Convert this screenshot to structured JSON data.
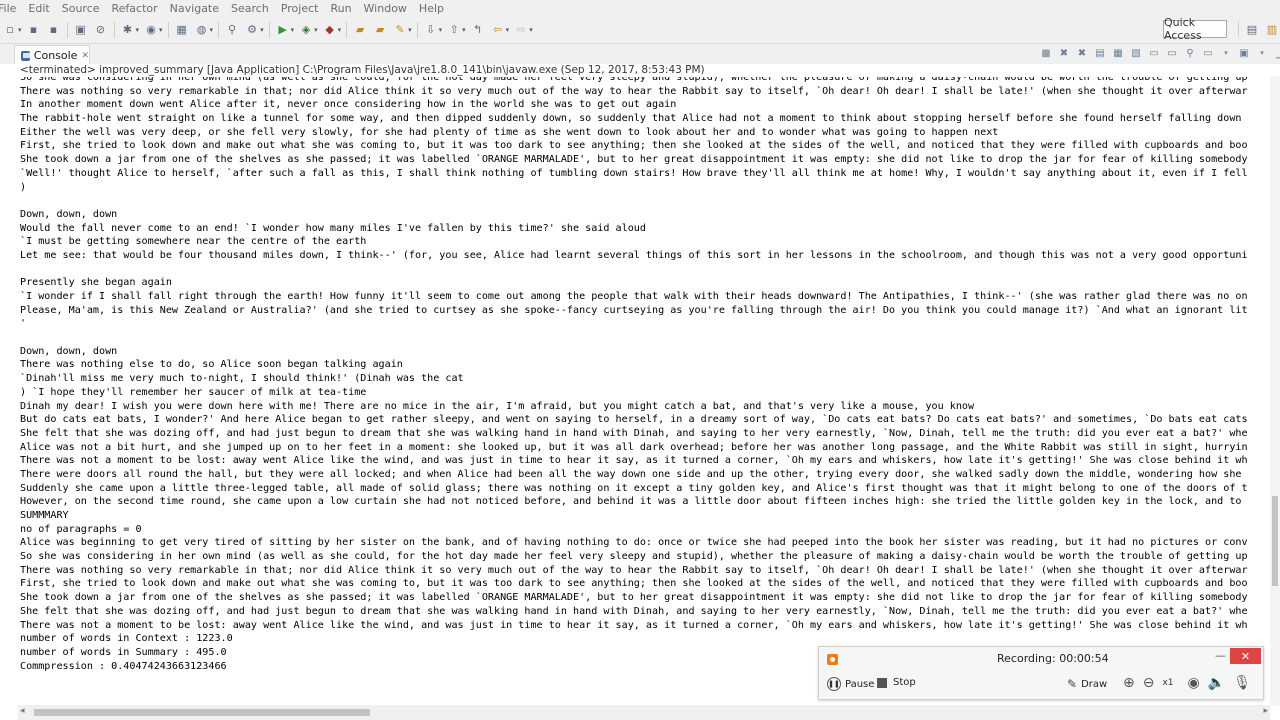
{
  "menu": [
    "File",
    "Edit",
    "Source",
    "Refactor",
    "Navigate",
    "Search",
    "Project",
    "Run",
    "Window",
    "Help"
  ],
  "toolbar": {
    "quick_access": "Quick Access"
  },
  "console_view": {
    "tab_label": "Console",
    "tab_close": "✕",
    "status": "<terminated> improved_summary [Java Application] C:\\Program Files\\Java\\jre1.8.0_141\\bin\\javaw.exe (Sep 12, 2017, 8:53:43 PM)"
  },
  "lines": [
    "So she was considering in her own mind (as well as she could, for the hot day made her feel very sleepy and stupid), whether the pleasure of making a daisy-chain would be worth the trouble of getting up",
    "There was nothing so very remarkable in that; nor did Alice think it so very much out of the way to hear the Rabbit say to itself, `Oh dear! Oh dear! I shall be late!' (when she thought it over afterwar",
    "In another moment down went Alice after it, never once considering how in the world she was to get out again",
    "The rabbit-hole went straight on like a tunnel for some way, and then dipped suddenly down, so suddenly that Alice had not a moment to think about stopping herself before she found herself falling down",
    "Either the well was very deep, or she fell very slowly, for she had plenty of time as she went down to look about her and to wonder what was going to happen next",
    "First, she tried to look down and make out what she was coming to, but it was too dark to see anything; then she looked at the sides of the well, and noticed that they were filled with cupboards and boo",
    "She took down a jar from one of the shelves as she passed; it was labelled `ORANGE MARMALADE', but to her great disappointment it was empty: she did not like to drop the jar for fear of killing somebody",
    "`Well!' thought Alice to herself, `after such a fall as this, I shall think nothing of tumbling down stairs! How brave they'll all think me at home! Why, I wouldn't say anything about it, even if I fell",
    ")",
    "",
    "Down, down, down",
    "Would the fall never come to an end! `I wonder how many miles I've fallen by this time?' she said aloud",
    "`I must be getting somewhere near the centre of the earth",
    "Let me see: that would be four thousand miles down, I think--' (for, you see, Alice had learnt several things of this sort in her lessons in the schoolroom, and though this was not a very good opportuni",
    "",
    "Presently she began again",
    "`I wonder if I shall fall right through the earth! How funny it'll seem to come out among the people that walk with their heads downward! The Antipathies, I think--' (she was rather glad there was no on",
    "Please, Ma'am, is this New Zealand or Australia?' (and she tried to curtsey as she spoke--fancy curtseying as you're falling through the air! Do you think you could manage it?) `And what an ignorant lit",
    "'",
    "",
    "Down, down, down",
    "There was nothing else to do, so Alice soon began talking again",
    "`Dinah'll miss me very much to-night, I should think!' (Dinah was the cat",
    ") `I hope they'll remember her saucer of milk at tea-time",
    "Dinah my dear! I wish you were down here with me! There are no mice in the air, I'm afraid, but you might catch a bat, and that's very like a mouse, you know",
    "But do cats eat bats, I wonder?' And here Alice began to get rather sleepy, and went on saying to herself, in a dreamy sort of way, `Do cats eat bats? Do cats eat bats?' and sometimes, `Do bats eat cats",
    "She felt that she was dozing off, and had just begun to dream that she was walking hand in hand with Dinah, and saying to her very earnestly, `Now, Dinah, tell me the truth: did you ever eat a bat?' whe",
    "Alice was not a bit hurt, and she jumped up on to her feet in a moment: she looked up, but it was all dark overhead; before her was another long passage, and the White Rabbit was still in sight, hurryin",
    "There was not a moment to be lost: away went Alice like the wind, and was just in time to hear it say, as it turned a corner, `Oh my ears and whiskers, how late it's getting!' She was close behind it wh",
    "There were doors all round the hall, but they were all locked; and when Alice had been all the way down one side and up the other, trying every door, she walked sadly down the middle, wondering how she",
    "Suddenly she came upon a little three-legged table, all made of solid glass; there was nothing on it except a tiny golden key, and Alice's first thought was that it might belong to one of the doors of t",
    "However, on the second time round, she came upon a low curtain she had not noticed before, and behind it was a little door about fifteen inches high: she tried the little golden key in the lock, and to",
    "SUMMMARY",
    "no of paragraphs = 0",
    "Alice was beginning to get very tired of sitting by her sister on the bank, and of having nothing to do: once or twice she had peeped into the book her sister was reading, but it had no pictures or conv",
    "So she was considering in her own mind (as well as she could, for the hot day made her feel very sleepy and stupid), whether the pleasure of making a daisy-chain would be worth the trouble of getting up",
    "There was nothing so very remarkable in that; nor did Alice think it so very much out of the way to hear the Rabbit say to itself, `Oh dear! Oh dear! I shall be late!' (when she thought it over afterwar",
    "First, she tried to look down and make out what she was coming to, but it was too dark to see anything; then she looked at the sides of the well, and noticed that they were filled with cupboards and boo",
    "She took down a jar from one of the shelves as she passed; it was labelled `ORANGE MARMALADE', but to her great disappointment it was empty: she did not like to drop the jar for fear of killing somebody",
    "She felt that she was dozing off, and had just begun to dream that she was walking hand in hand with Dinah, and saying to her very earnestly, `Now, Dinah, tell me the truth: did you ever eat a bat?' whe",
    "There was not a moment to be lost: away went Alice like the wind, and was just in time to hear it say, as it turned a corner, `Oh my ears and whiskers, how late it's getting!' She was close behind it wh",
    "number of words in Context : 1223.0",
    "number of words in Summary : 495.0",
    "Commpression : 0.40474243663123466"
  ],
  "recorder": {
    "title": "Recording:  00:00:54",
    "pause": "Pause",
    "stop": "Stop",
    "draw": "Draw",
    "zoom": "x1",
    "close": "✕",
    "minimize": "—"
  }
}
